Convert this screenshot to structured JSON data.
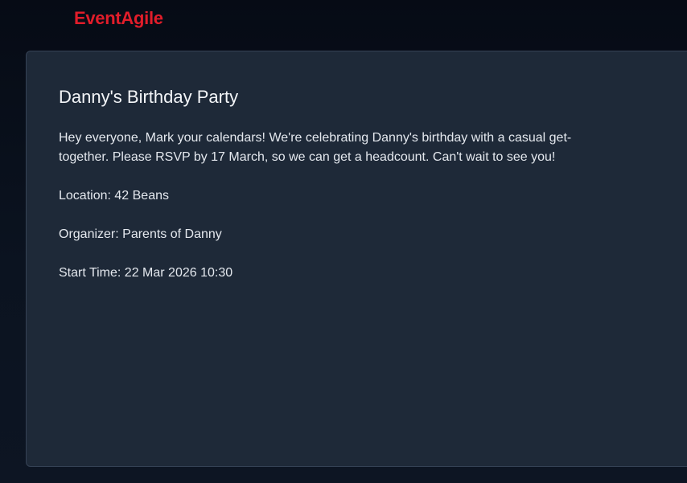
{
  "app": {
    "brand": "EventAgile"
  },
  "event": {
    "title": "Danny's Birthday Party",
    "description": "Hey everyone, Mark your calendars! We're celebrating Danny's birthday with a casual get-together. Please RSVP by 17 March, so we can get a headcount. Can't wait to see you!",
    "location": "Location: 42 Beans",
    "organizer": "Organizer: Parents of Danny",
    "start_time": "Start Time: 22 Mar 2026 10:30"
  },
  "colors": {
    "brand": "#e11d2a",
    "background": "#050a14",
    "card": "#1e2938",
    "text": "#e4e8ee"
  }
}
